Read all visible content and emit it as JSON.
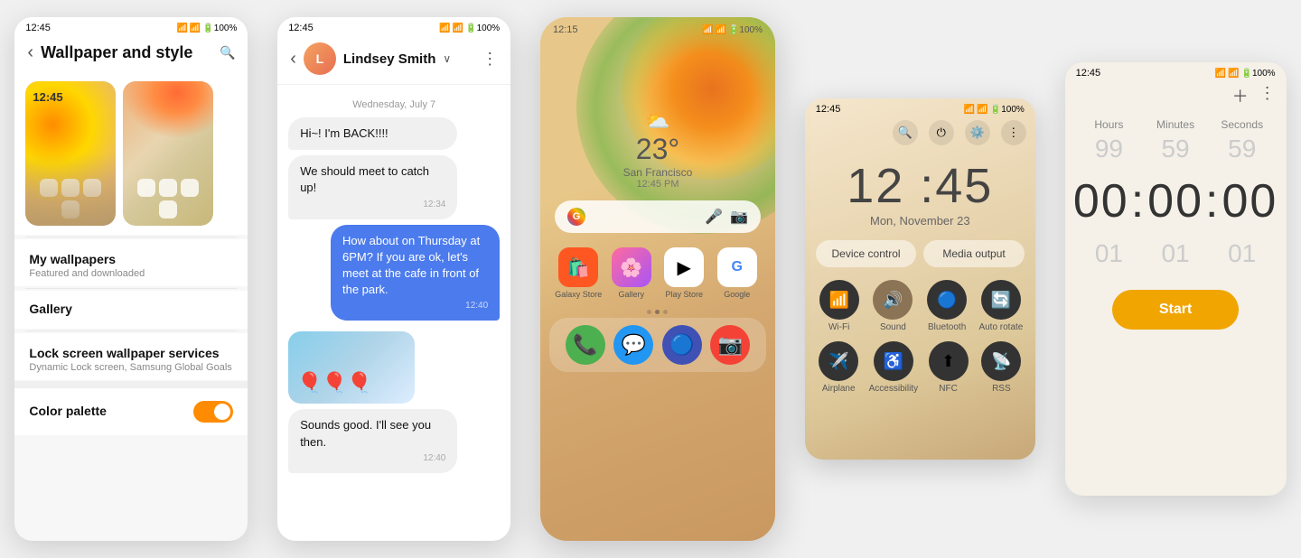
{
  "panel1": {
    "status_time": "12:45",
    "title": "Wallpaper and style",
    "wallpaper_time": "12:45",
    "menu": {
      "my_wallpapers": "My wallpapers",
      "my_wallpapers_sub": "Featured and downloaded",
      "gallery": "Gallery",
      "lock_screen": "Lock screen wallpaper services",
      "lock_screen_sub": "Dynamic Lock screen, Samsung Global Goals",
      "color_palette": "Color palette"
    }
  },
  "panel2": {
    "status_time": "12:45",
    "contact_name": "Lindsey Smith",
    "date_divider": "Wednesday, July 7",
    "messages": [
      {
        "text": "Hi~! I'm BACK!!!!",
        "type": "received"
      },
      {
        "text": "We should meet to catch up!",
        "type": "received",
        "time": "12:34"
      },
      {
        "text": "How about on Thursday at 6PM? If you are ok, let's meet at the cafe in front of the park.",
        "type": "sent",
        "time": "12:40"
      },
      {
        "text": "Sounds good. I'll see you then.",
        "type": "received",
        "time": "12:40"
      }
    ]
  },
  "panel3": {
    "status_time": "12:15",
    "weather_icon": "⛅",
    "temperature": "23°",
    "city": "San Francisco",
    "time_display": "12:45 PM",
    "apps": [
      {
        "name": "Galaxy Store",
        "emoji": "🛍️"
      },
      {
        "name": "Gallery",
        "emoji": "🌸"
      },
      {
        "name": "Play Store",
        "emoji": "▶"
      },
      {
        "name": "Google",
        "emoji": "G"
      }
    ],
    "dock": [
      {
        "name": "Phone",
        "emoji": "📞"
      },
      {
        "name": "Messages",
        "emoji": "💬"
      },
      {
        "name": "Samsung",
        "emoji": "🔵"
      },
      {
        "name": "Camera",
        "emoji": "📷"
      }
    ]
  },
  "panel4": {
    "status_time": "12:45",
    "clock": "12 :45",
    "date": "Mon, November 23",
    "device_control": "Device control",
    "media_output": "Media output",
    "quick_icons": [
      {
        "label": "Wi-Fi",
        "icon": "📶",
        "active": false
      },
      {
        "label": "Sound",
        "icon": "🔊",
        "active": true
      },
      {
        "label": "Bluetooth",
        "icon": "🔵",
        "active": false
      },
      {
        "label": "Auto rotate",
        "icon": "🔄",
        "active": false
      },
      {
        "label": "Airplane",
        "icon": "✈️",
        "active": false
      },
      {
        "label": "Accessibility",
        "icon": "♿",
        "active": false
      },
      {
        "label": "NFC",
        "icon": "⬆",
        "active": false
      },
      {
        "label": "RSS",
        "icon": "📡",
        "active": false
      }
    ]
  },
  "panel5": {
    "status_time": "12:45",
    "labels": [
      "Hours",
      "Minutes",
      "Seconds"
    ],
    "top_nums": [
      "99",
      "59",
      "59"
    ],
    "main_display": [
      "00",
      "00",
      "00"
    ],
    "bottom_nums": [
      "01",
      "01",
      "01"
    ],
    "start_label": "Start"
  }
}
